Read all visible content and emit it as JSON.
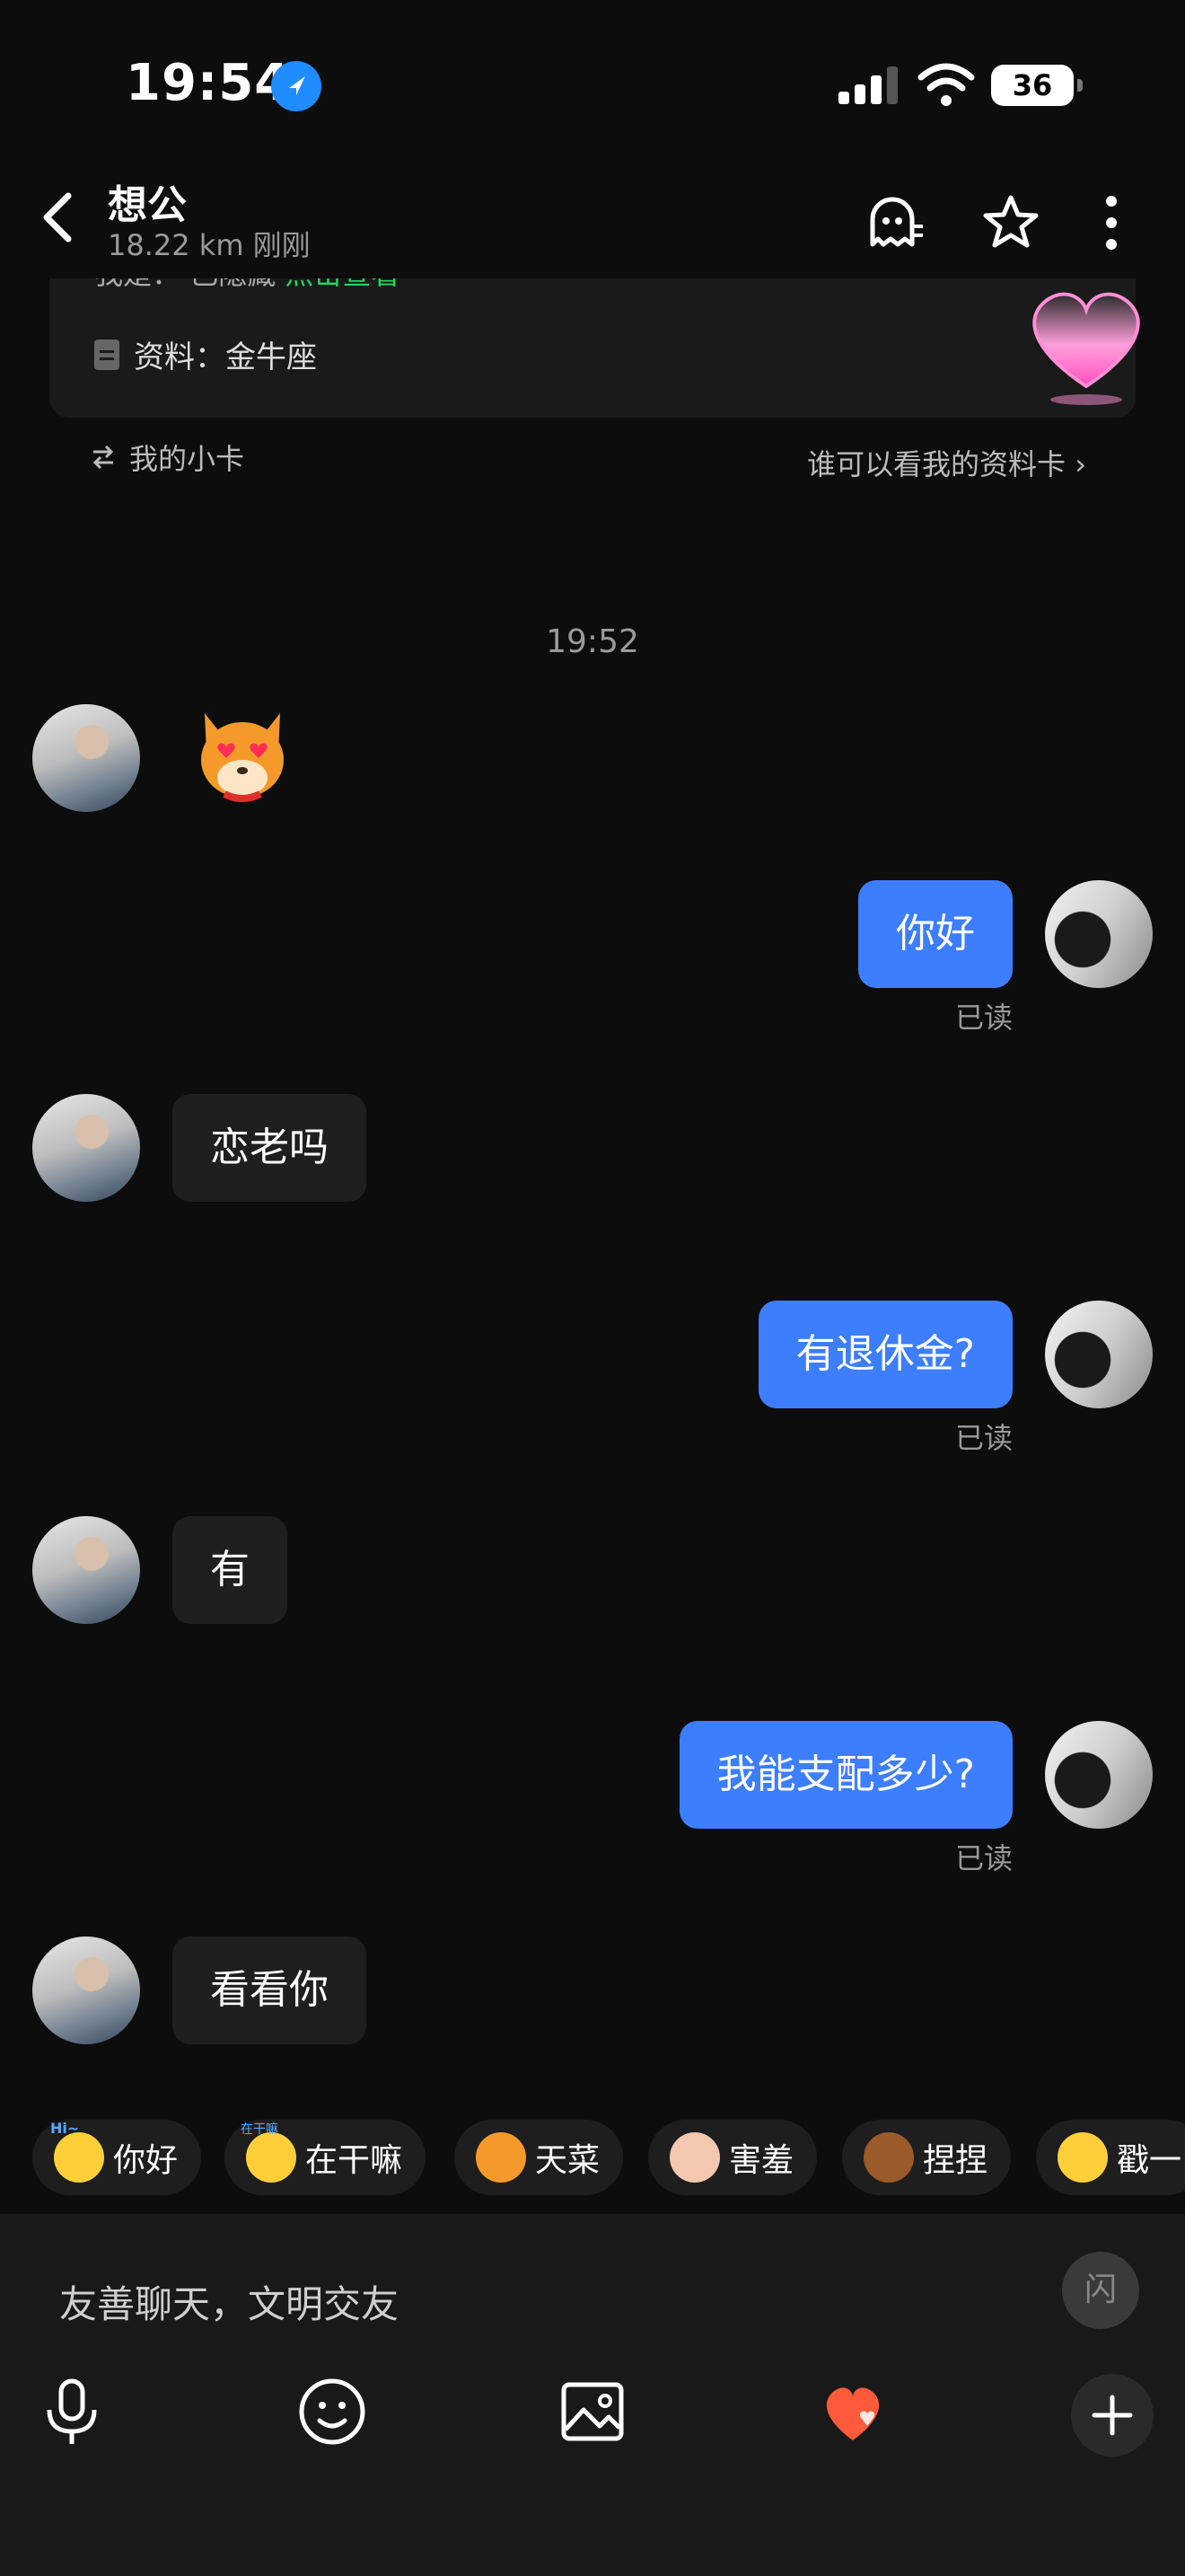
{
  "status_bar": {
    "time": "19:54",
    "battery": "36"
  },
  "header": {
    "name": "想公",
    "distance": "18.22 km",
    "last_active": "刚刚"
  },
  "profile_card": {
    "hidden_row": {
      "label": "我是：",
      "value": "已隐藏",
      "action": "点击查看"
    },
    "info_row": {
      "label": "资料：",
      "value": "金牛座"
    },
    "my_card_label": "我的小卡",
    "visibility_link": "谁可以看我的资料卡 ›"
  },
  "chat": {
    "timestamp": "19:52",
    "messages": [
      {
        "from": "peer",
        "type": "sticker",
        "sticker": "heart-eyes-dog-sticker"
      },
      {
        "from": "me",
        "text": "你好",
        "status": "已读"
      },
      {
        "from": "peer",
        "text": "恋老吗"
      },
      {
        "from": "me",
        "text": "有退休金?",
        "status": "已读"
      },
      {
        "from": "peer",
        "text": "有"
      },
      {
        "from": "me",
        "text": "我能支配多少?",
        "status": "已读"
      },
      {
        "from": "peer",
        "text": "看看你"
      }
    ]
  },
  "quick_replies": [
    {
      "label": "你好",
      "icon": "hi-face-icon",
      "badge": "Hi~"
    },
    {
      "label": "在干嘛",
      "icon": "kiss-face-icon",
      "badge": "在干嘛"
    },
    {
      "label": "天菜",
      "icon": "cat-face-icon"
    },
    {
      "label": "害羞",
      "icon": "shy-icon"
    },
    {
      "label": "捏捏",
      "icon": "bear-icon"
    },
    {
      "label": "戳一",
      "icon": "pointing-hand-icon"
    }
  ],
  "input": {
    "placeholder": "友善聊天，文明交友",
    "flash_label": "闪"
  },
  "colors": {
    "outgoing_bubble": "#3d7eff",
    "incoming_bubble": "#1f1f1f",
    "background": "#0d0d0d",
    "accent_green": "#1ed760",
    "heart": "#ff5a3c"
  }
}
